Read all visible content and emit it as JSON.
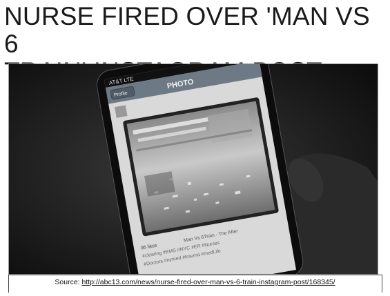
{
  "slide": {
    "title_line1": "NURSE FIRED OVER 'MAN VS 6",
    "title_line2": "TRAIN' INSTAGRAM POST"
  },
  "phone": {
    "carrier": "AT&T LTE",
    "header_title": "PHOTO",
    "back_button": "Profile",
    "likes": "96 likes",
    "caption": "Man Vs 6Train - The After",
    "hashtags_line1": "#clearing #EMS #NYC #ER #Nurses",
    "hashtags_line2": "#Doctors #nymed #trauma #medLife"
  },
  "source": {
    "label": "Source:",
    "url": "http://abc13.com/news/nurse-fired-over-man-vs-6-train-instagram-post/168345/"
  },
  "colors": {
    "background": "#ffffff",
    "photo_dark": "#1a1a1a"
  }
}
